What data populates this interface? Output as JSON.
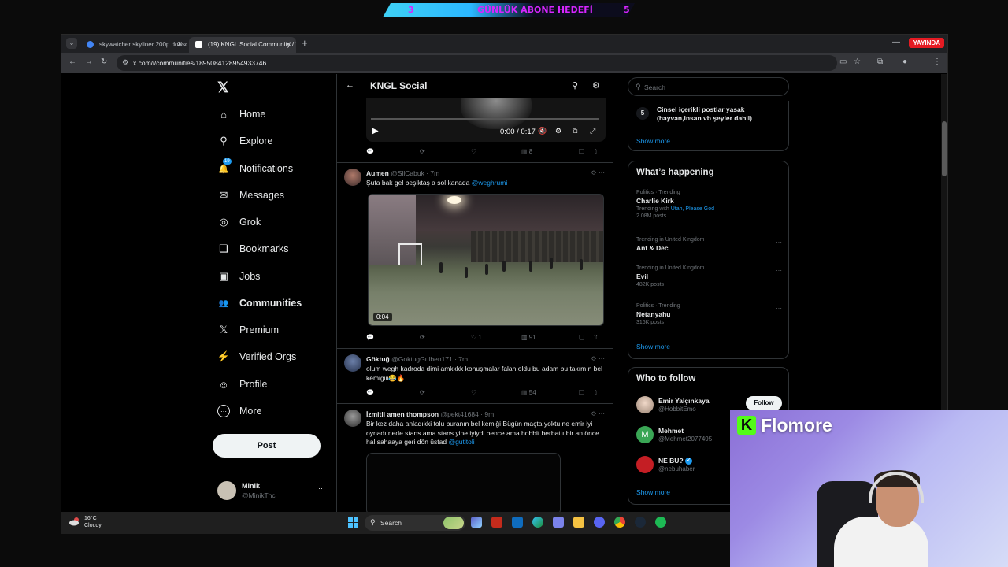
{
  "banner": {
    "left_num": "3",
    "text": "GÜNLÜK ABONE HEDEFİ",
    "right_num": "5"
  },
  "browser": {
    "tabs": [
      {
        "title": "skywatcher skyliner 200p dobso",
        "active": false
      },
      {
        "title": "(19) KNGL Social Community / X",
        "active": true
      }
    ],
    "live_badge": "YAYINDA",
    "url": "x.com/i/communities/1895084128954933746"
  },
  "sidebar": {
    "logo": "𝕏",
    "items": [
      {
        "label": "Home",
        "icon": "home-icon",
        "glyph": "⌂"
      },
      {
        "label": "Explore",
        "icon": "search-icon",
        "glyph": "⚲"
      },
      {
        "label": "Notifications",
        "icon": "bell-icon",
        "glyph": "🔔",
        "badge": "19"
      },
      {
        "label": "Messages",
        "icon": "envelope-icon",
        "glyph": "✉"
      },
      {
        "label": "Grok",
        "icon": "grok-icon",
        "glyph": "◎"
      },
      {
        "label": "Bookmarks",
        "icon": "bookmark-icon",
        "glyph": "❏"
      },
      {
        "label": "Jobs",
        "icon": "briefcase-icon",
        "glyph": "▣"
      },
      {
        "label": "Communities",
        "icon": "people-icon",
        "glyph": "👥"
      },
      {
        "label": "Premium",
        "icon": "x-icon",
        "glyph": "𝕏"
      },
      {
        "label": "Verified Orgs",
        "icon": "bolt-icon",
        "glyph": "⚡"
      },
      {
        "label": "Profile",
        "icon": "person-icon",
        "glyph": "☺"
      },
      {
        "label": "More",
        "icon": "more-icon",
        "glyph": "⋯"
      }
    ],
    "post_label": "Post",
    "account": {
      "name": "Minik",
      "handle": "@MinikTncl"
    }
  },
  "center": {
    "title": "KNGL Social",
    "video1": {
      "time": "0:00 / 0:17"
    },
    "tweet0_actions": {
      "views": "8"
    },
    "tweets": [
      {
        "name": "Aumen",
        "handle": "@SllCabuk · 7m",
        "text": "Şuta bak gel beşiktaş a sol kanada ",
        "mention": "@weghrumi",
        "video_duration": "0:04",
        "likes": "1",
        "views": "91"
      },
      {
        "name": "Göktuğ",
        "handle": "@GoktugGulben171 · 7m",
        "text": "olum wegh kadroda dimi amkkkk konuşmalar falan oldu bu adam bu takımın bel kemiğiii😂🔥",
        "views": "54"
      },
      {
        "name": "İzmitli amen thompson",
        "handle": "@pekt41684 · 9m",
        "text": "Bir kez daha anladıkki tolu buranın bel kemiği Bügün maçta yoktu ne emir iyi oynadı nede stans ama stans yine iyiydi bence ama hobbit berbattı bir an önce halısahaaya geri dön üstad ",
        "mention": "@gutitoli"
      }
    ]
  },
  "right": {
    "search_placeholder": "Search",
    "rules": {
      "num": "5",
      "text": "Cinsel içerikli postlar yasak (hayvan,insan vb şeyler dahil)",
      "show_more": "Show more"
    },
    "happening": {
      "title": "What’s happening",
      "trends": [
        {
          "meta": "Politics · Trending",
          "topic": "Charlie Kirk",
          "extra_prefix": "Trending with ",
          "extra_link": "Utah, Please God",
          "count": "2.08M posts"
        },
        {
          "meta": "Trending in United Kingdom",
          "topic": "Ant & Dec",
          "count": ""
        },
        {
          "meta": "Trending in United Kingdom",
          "topic": "Evil",
          "count": "482K posts"
        },
        {
          "meta": "Politics · Trending",
          "topic": "Netanyahu",
          "count": "316K posts"
        }
      ],
      "show_more": "Show more"
    },
    "who_to_follow": {
      "title": "Who to follow",
      "accounts": [
        {
          "name": "Emir Yalçınkaya",
          "handle": "@HobbitEmo"
        },
        {
          "name": "Mehmet",
          "handle": "@Mehmet2077495",
          "initial": "M"
        },
        {
          "name": "NE BU?",
          "handle": "@nebuhaber",
          "verified": true
        }
      ],
      "follow_label": "Follow",
      "show_more": "Show more"
    }
  },
  "taskbar": {
    "weather": {
      "temp": "16°C",
      "condition": "Cloudy"
    },
    "search_label": "Search"
  },
  "overlay": {
    "brand_letter": "K",
    "brand_name": "Flomore"
  },
  "colors": {
    "accent": "#1d9bf0",
    "live": "#e51b23",
    "kick_green": "#53fc18"
  }
}
